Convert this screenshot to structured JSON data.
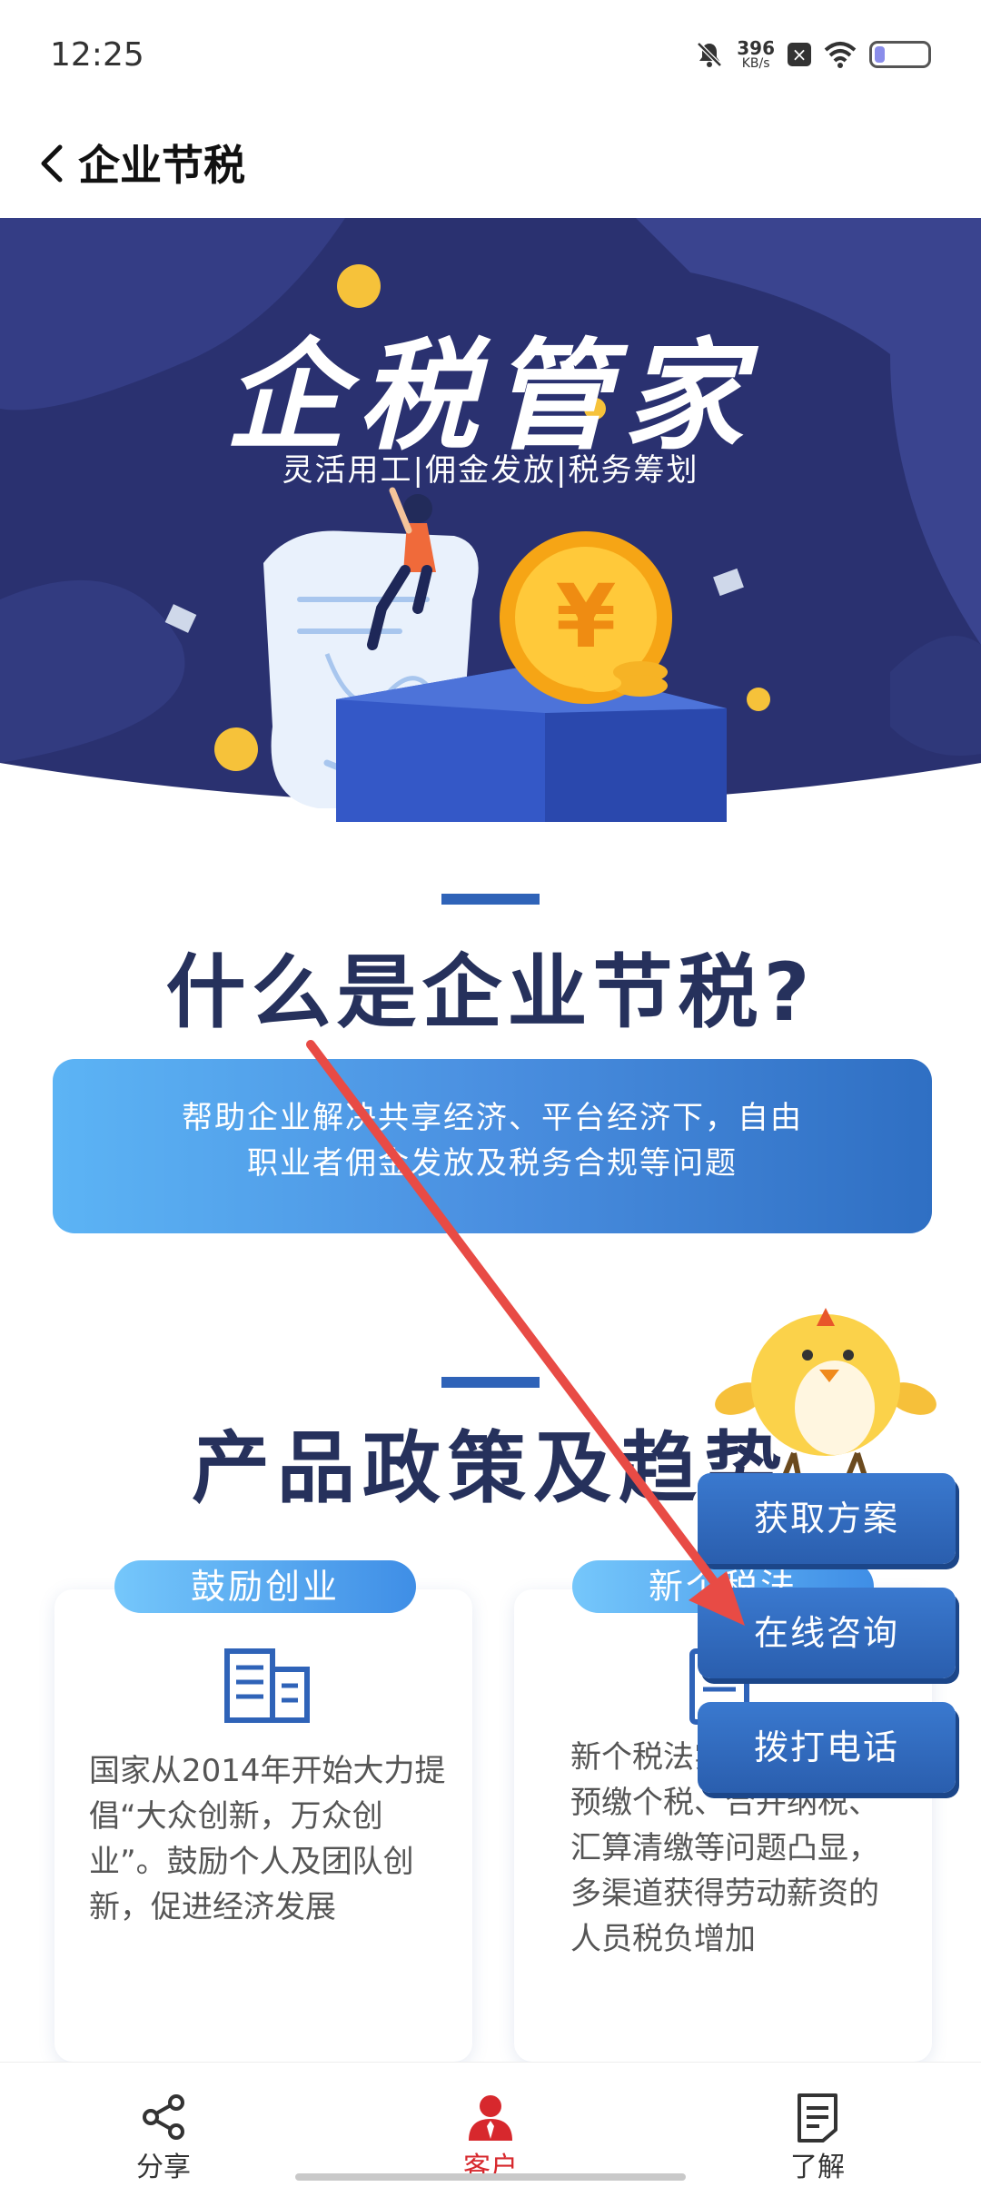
{
  "status_bar": {
    "time": "12:25",
    "net_speed": "396",
    "net_unit": "KB/s",
    "icons": [
      "bell-mute-icon",
      "close-box-icon",
      "wifi-icon",
      "battery-icon"
    ],
    "battery_level": 0.2
  },
  "header": {
    "title": "企业节税"
  },
  "banner": {
    "title": "企税管家",
    "subtitle": "灵活用工|佣金发放|税务筹划",
    "coin_symbol": "¥",
    "colors": {
      "bg_dark": "#2a3170",
      "bg_mid": "#3a448f",
      "coin": "#f5b020"
    }
  },
  "section1": {
    "title": "什么是企业节税?",
    "description_line1": "帮助企业解决共享经济、平台经济下，自由",
    "description_line2": "职业者佣金发放及税务合规等问题"
  },
  "section2": {
    "title": "产品政策及趋势",
    "cards": [
      {
        "tag": "鼓励创业",
        "icon": "building-icon",
        "text": "国家从2014年开始大力提倡“大众创新，万众创业”。鼓励个人及团队创新，促进经济发展"
      },
      {
        "tag": "新个税法",
        "icon": "tax-document-icon",
        "text": "新个税法实施后，预扣预缴个税、合并纳税、汇算清缴等问题凸显，多渠道获得劳动薪资的人员税负增加"
      }
    ]
  },
  "floating": {
    "buttons": [
      "获取方案",
      "在线咨询",
      "拨打电话"
    ]
  },
  "bottom_nav": [
    {
      "label": "分享",
      "icon": "share-icon",
      "active": false
    },
    {
      "label": "客户",
      "icon": "person-icon",
      "active": true
    },
    {
      "label": "了解",
      "icon": "document-icon",
      "active": false
    }
  ],
  "colors": {
    "accent_blue": "#2f63b8",
    "title_navy": "#26315c",
    "active_red": "#d7282d"
  }
}
